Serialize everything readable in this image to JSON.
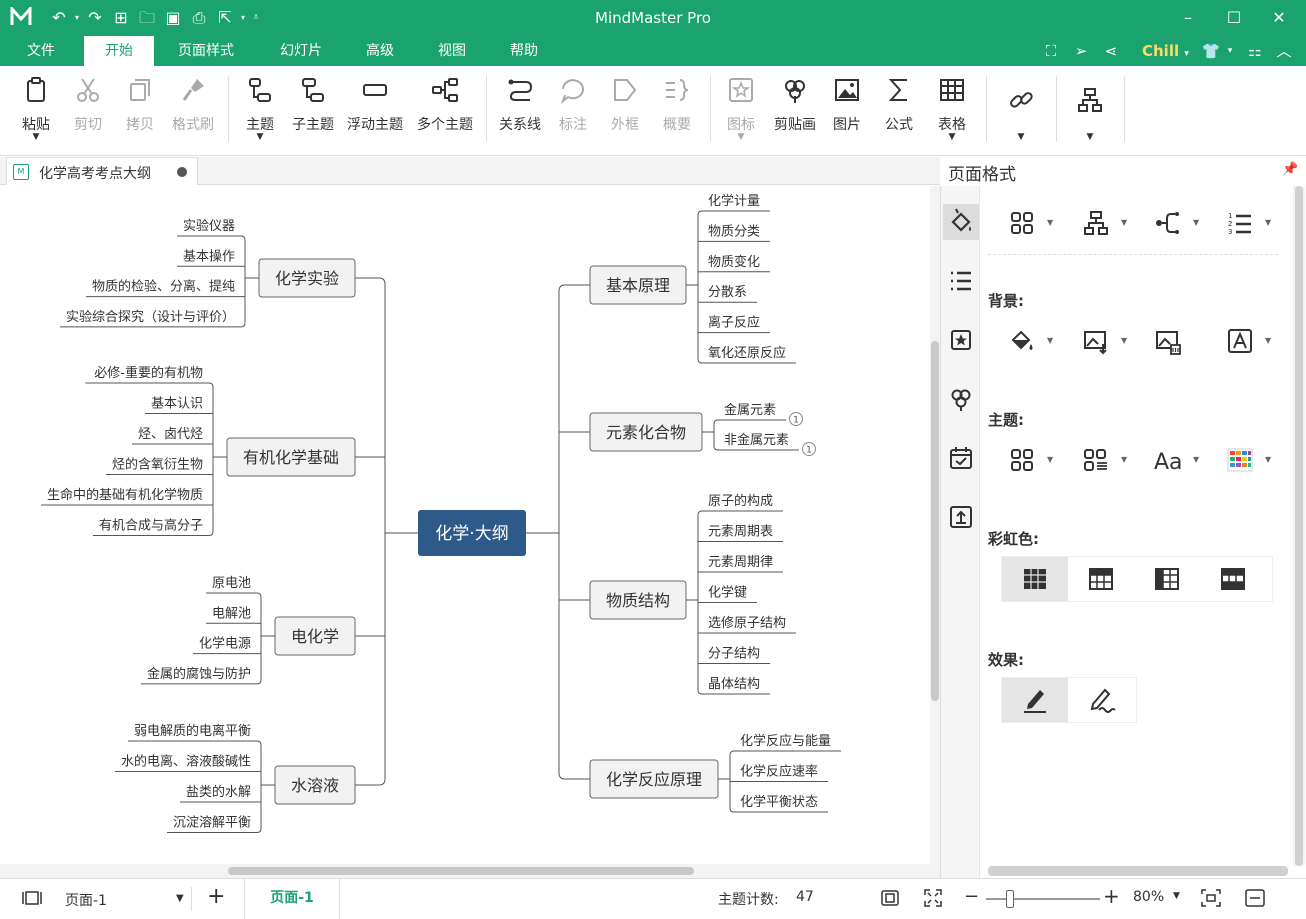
{
  "app": {
    "title": "MindMaster Pro",
    "quick_access": [
      "logo-icon",
      "undo-icon",
      "redo-icon",
      "new-icon",
      "open-icon",
      "save-icon",
      "print-icon",
      "export-icon",
      "customize-icon"
    ]
  },
  "menu": {
    "tabs": [
      "文件",
      "开始",
      "页面样式",
      "幻灯片",
      "高级",
      "视图",
      "帮助"
    ],
    "active_tab": "开始",
    "theme_name": "Chill"
  },
  "ribbon": {
    "paste": "粘贴",
    "cut": "剪切",
    "copy": "拷贝",
    "format_painter": "格式刷",
    "topic": "主题",
    "subtopic": "子主题",
    "floating_topic": "浮动主题",
    "multiple_topics": "多个主题",
    "relationship": "关系线",
    "callout": "标注",
    "boundary": "外框",
    "summary": "概要",
    "icon": "图标",
    "clipart": "剪贴画",
    "picture": "图片",
    "formula": "公式",
    "table": "表格"
  },
  "document": {
    "tab_title": "化学高考考点大纲"
  },
  "mindmap": {
    "root": "化学·大纲",
    "left": [
      {
        "title": "化学实验",
        "children": [
          "实验仪器",
          "基本操作",
          "物质的检验、分离、提纯",
          "实验综合探究（设计与评价）"
        ]
      },
      {
        "title": "有机化学基础",
        "children": [
          "必修-重要的有机物",
          "基本认识",
          "烃、卤代烃",
          "烃的含氧衍生物",
          "生命中的基础有机化学物质",
          "有机合成与高分子"
        ]
      },
      {
        "title": "电化学",
        "children": [
          "原电池",
          "电解池",
          "化学电源",
          "金属的腐蚀与防护"
        ]
      },
      {
        "title": "水溶液",
        "children": [
          "弱电解质的电离平衡",
          "水的电离、溶液酸碱性",
          "盐类的水解",
          "沉淀溶解平衡"
        ]
      }
    ],
    "right": [
      {
        "title": "基本原理",
        "children": [
          "化学计量",
          "物质分类",
          "物质变化",
          "分散系",
          "离子反应",
          "氧化还原反应"
        ]
      },
      {
        "title": "元素化合物",
        "children": [
          "金属元素",
          "非金属元素"
        ],
        "badges": [
          "1",
          "1"
        ]
      },
      {
        "title": "物质结构",
        "children": [
          "原子的构成",
          "元素周期表",
          "元素周期律",
          "化学键",
          "选修原子结构",
          "分子结构",
          "晶体结构"
        ]
      },
      {
        "title": "化学反应原理",
        "children": [
          "化学反应与能量",
          "化学反应速率",
          "化学平衡状态"
        ]
      }
    ]
  },
  "panel": {
    "title": "页面格式",
    "sections": {
      "background": "背景:",
      "theme": "主题:",
      "rainbow": "彩虹色:",
      "effect": "效果:"
    }
  },
  "status": {
    "page_select": "页面-1",
    "page_tab": "页面-1",
    "topic_count_label": "主题计数:",
    "topic_count": "47",
    "zoom": "80%"
  },
  "colors": {
    "brand": "#1aa36e",
    "root_fill": "#2e5a8a",
    "topic_fill": "#f2f2f2",
    "line": "#555555"
  }
}
